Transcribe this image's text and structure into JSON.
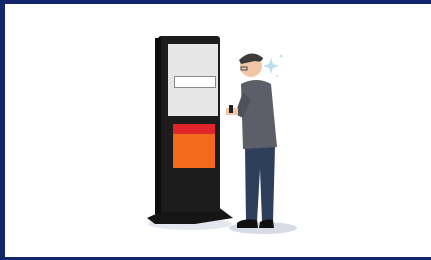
{
  "kiosk": {
    "screen_text": "",
    "alert_title": "",
    "alert_lines": [
      "",
      "",
      ""
    ]
  },
  "colors": {
    "border": "#12256a",
    "kiosk_body": "#1c1c1c",
    "screen": "#e6e6e6",
    "alert_red": "#e0262b",
    "alert_orange": "#f26a1b",
    "jacket": "#5d5f68",
    "jeans": "#2e3f5c",
    "hair": "#3b3b3b",
    "skin": "#f1c7a8",
    "shadow": "#d8dbe6"
  },
  "icons": [
    "kiosk-icon",
    "person-icon",
    "confusion-sparkle-icon",
    "phone-icon"
  ]
}
